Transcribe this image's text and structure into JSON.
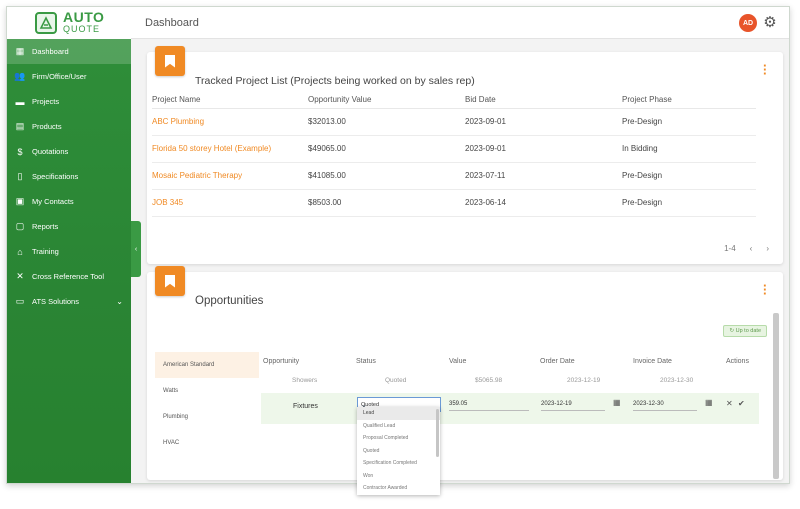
{
  "app": {
    "logo_auto": "AUTO",
    "logo_quote": "QUOTE"
  },
  "topbar": {
    "title": "Dashboard",
    "avatar_initials": "AD"
  },
  "sidebar": {
    "items": [
      {
        "label": "Dashboard",
        "icon": "dashboard-icon"
      },
      {
        "label": "Firm/Office/User",
        "icon": "users-icon"
      },
      {
        "label": "Projects",
        "icon": "folder-icon"
      },
      {
        "label": "Products",
        "icon": "products-icon"
      },
      {
        "label": "Quotations",
        "icon": "dollar-icon"
      },
      {
        "label": "Specifications",
        "icon": "document-icon"
      },
      {
        "label": "My Contacts",
        "icon": "contacts-icon"
      },
      {
        "label": "Reports",
        "icon": "clipboard-icon"
      },
      {
        "label": "Training",
        "icon": "training-icon"
      },
      {
        "label": "Cross Reference Tool",
        "icon": "cross-reference-icon"
      },
      {
        "label": "ATS Solutions",
        "icon": "monitor-icon"
      }
    ]
  },
  "tracked": {
    "title": "Tracked Project List (Projects being worked on by sales rep)",
    "columns": [
      "Project Name",
      "Opportunity Value",
      "Bid Date",
      "Project Phase"
    ],
    "rows": [
      [
        "ABC Plumbing",
        "$32013.00",
        "2023-09-01",
        "Pre-Design"
      ],
      [
        "Florida 50 storey Hotel (Example)",
        "$49065.00",
        "2023-09-01",
        "In Bidding"
      ],
      [
        "Mosaic Pediatric Therapy",
        "$41085.00",
        "2023-07-11",
        "Pre-Design"
      ],
      [
        "JOB 345",
        "$8503.00",
        "2023-06-14",
        "Pre-Design"
      ]
    ],
    "pager_range": "1-4",
    "pager_prev": "‹",
    "pager_next": "›"
  },
  "opportunities": {
    "title": "Opportunities",
    "up_to_date": "↻ Up to date",
    "categories": [
      "American Standard",
      "Watts",
      "Plumbing",
      "HVAC"
    ],
    "columns": [
      "Opportunity",
      "Status",
      "Value",
      "Order Date",
      "Invoice Date",
      "Actions"
    ],
    "row1": {
      "opportunity": "Showers",
      "status": "Quoted",
      "value": "$5065.98",
      "order_date": "2023-12-19",
      "invoice_date": "2023-12-30"
    },
    "row2": {
      "opportunity": "Fixtures",
      "status": "Quoted",
      "value": "359.05",
      "order_date": "2023-12-19",
      "invoice_date": "2023-12-30"
    },
    "status_options": [
      "Lead",
      "Qualified Lead",
      "Proposal Completed",
      "Quoted",
      "Specification Completed",
      "Won",
      "Contractor Awarded"
    ]
  },
  "colors": {
    "sidebar": "#2f8f3a",
    "accent": "#f08a24",
    "avatar": "#e8542a"
  }
}
